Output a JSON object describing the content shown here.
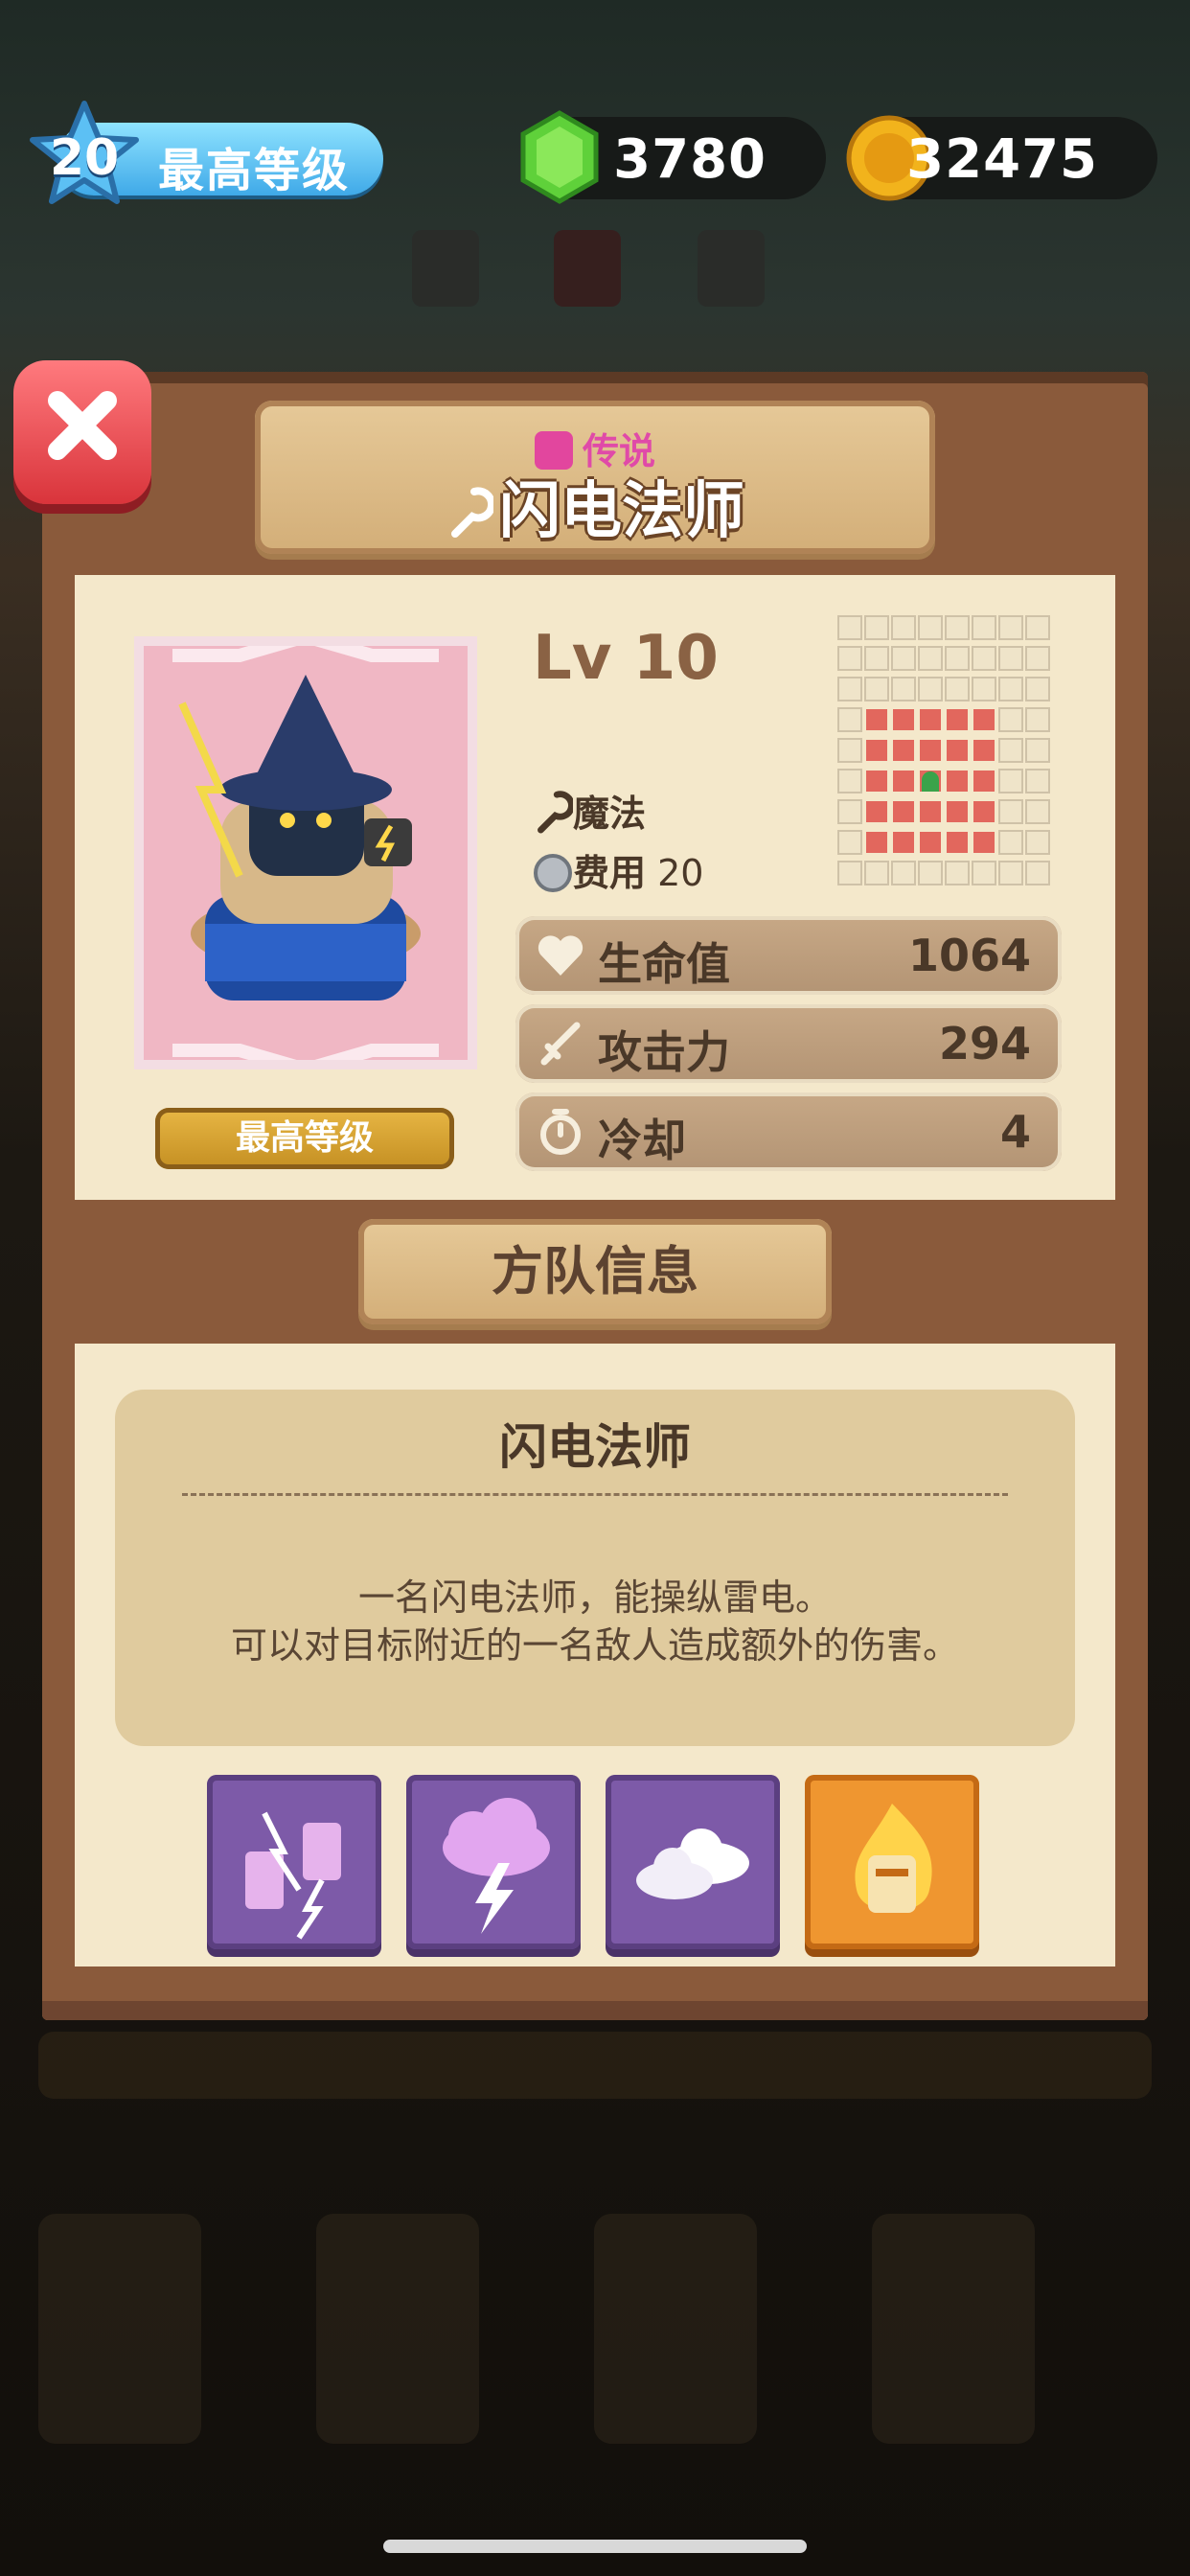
{
  "top_bar": {
    "player_level": "20",
    "level_label": "最高等级",
    "gems": "3780",
    "coins": "32475"
  },
  "unit": {
    "rarity": "传说",
    "name": "闪电法师",
    "level": "Lv 10",
    "type": "魔法",
    "cost_label": "费用",
    "cost_value": "20",
    "max_level_label": "最高等级",
    "stats": [
      {
        "label": "生命值",
        "value": "1064",
        "icon": "heart-icon"
      },
      {
        "label": "攻击力",
        "value": "294",
        "icon": "sword-icon"
      },
      {
        "label": "冷却",
        "value": "4",
        "icon": "stopwatch-icon"
      }
    ]
  },
  "squad": {
    "section_title": "方队信息",
    "desc_title": "闪电法师",
    "desc_lines": [
      "一名闪电法师，能操纵雷电。",
      "可以对目标附近的一名敌人造成额外的伤害。"
    ],
    "skills": [
      "chain-lightning-icon",
      "storm-cloud-icon",
      "cloud-icon",
      "fire-totem-icon"
    ]
  },
  "colors": {
    "accent_blue": "#3fa9e8",
    "gem_green": "#5fd13a",
    "coin_gold": "#f2b31c",
    "close_red": "#d9343b",
    "rarity_pink": "#e04aa8"
  }
}
